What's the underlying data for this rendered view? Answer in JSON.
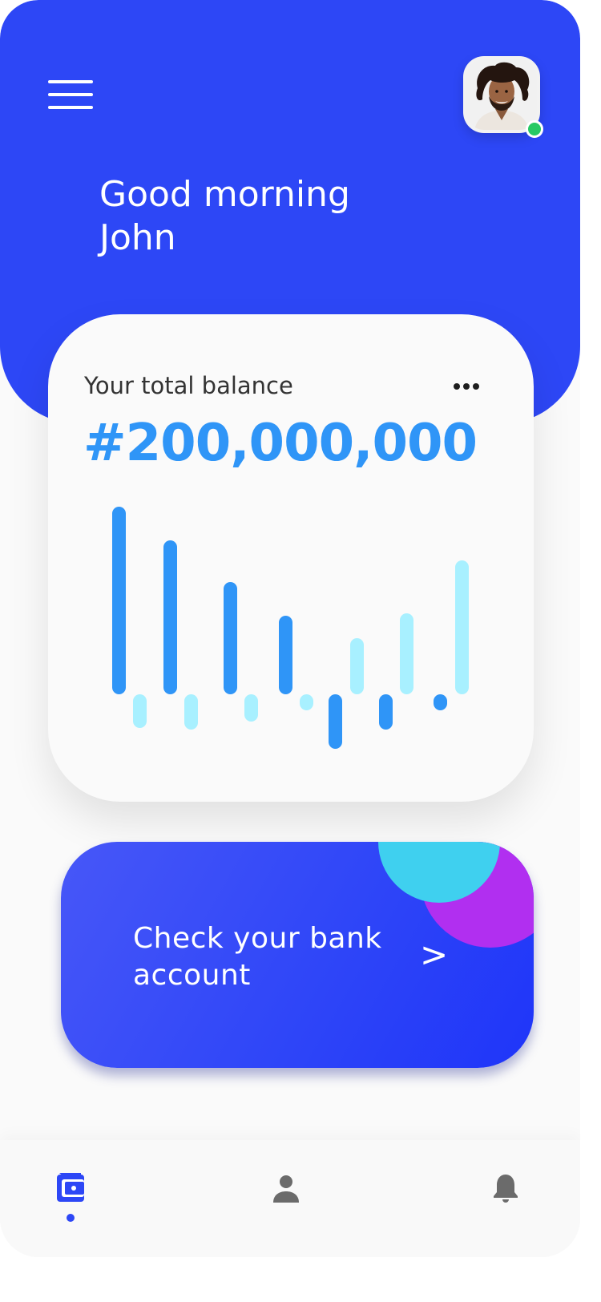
{
  "colors": {
    "header": "#2d47f6",
    "card_background": "#fafafa",
    "balance_amount": "#2f95f7",
    "bar_primary": "#2f95f7",
    "bar_secondary": "#a8f0ff",
    "online_status": "#27c964",
    "bank_card": "#2f46f8",
    "nav_active": "#2d47f6",
    "nav_inactive": "#6b6b6b"
  },
  "header": {
    "menu_icon": "hamburger-menu-icon",
    "greeting_line1": "Good morning",
    "greeting_line2": "John",
    "avatar_status": "online"
  },
  "balance_card": {
    "label": "Your total balance",
    "amount": "#200,000,000",
    "more_icon": "more-horizontal-icon"
  },
  "chart_data": {
    "type": "bar",
    "x": [
      1,
      2,
      3,
      4,
      5,
      6,
      7
    ],
    "series": [
      {
        "values": [
          234,
          192,
          140,
          98,
          -68,
          -44,
          -20
        ]
      },
      {
        "values": [
          -42,
          -44,
          -34,
          -20,
          70,
          101,
          167
        ]
      }
    ],
    "title": "",
    "xlabel": "",
    "ylabel": "",
    "ylim": [
      -70,
      240
    ],
    "grid": false,
    "legend": "none"
  },
  "bank_card": {
    "line1": "Check your bank",
    "line2": "account",
    "arrow": ">"
  },
  "bottom_nav": {
    "items": [
      {
        "icon": "wallet-icon",
        "active": true
      },
      {
        "icon": "user-icon",
        "active": false
      },
      {
        "icon": "bell-icon",
        "active": false
      }
    ]
  }
}
